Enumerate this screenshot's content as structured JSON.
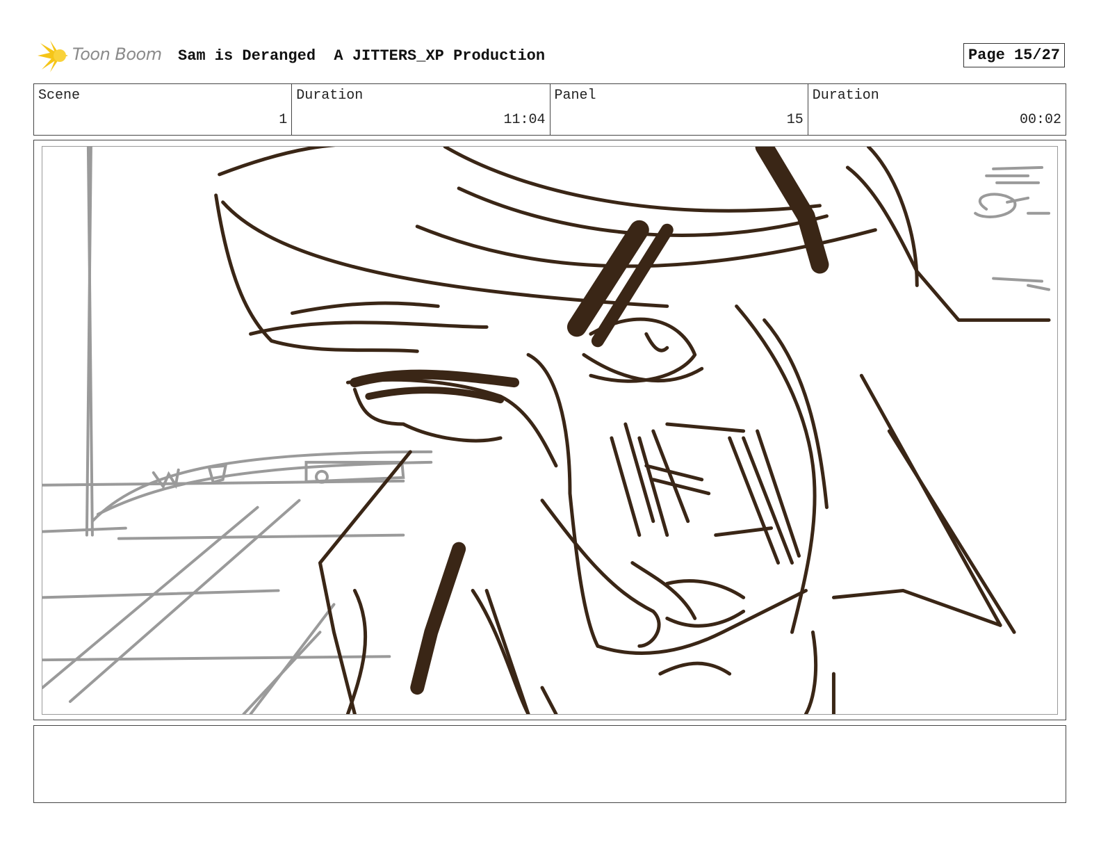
{
  "header": {
    "logo_text": "Toon Boom",
    "title": "Sam is Deranged  A JITTERS_XP Production",
    "page": "Page 15/27"
  },
  "meta": {
    "scene_label": "Scene",
    "scene_value": "1",
    "scene_duration_label": "Duration",
    "scene_duration_value": "11:04",
    "panel_label": "Panel",
    "panel_value": "15",
    "panel_duration_label": "Duration",
    "panel_duration_value": "00:02"
  },
  "colors": {
    "ink": "#3a2616",
    "rough": "#9a9a9a",
    "logo_flash": "#f5c518"
  },
  "icons": {
    "logo": "toon-boom-flash-icon"
  }
}
